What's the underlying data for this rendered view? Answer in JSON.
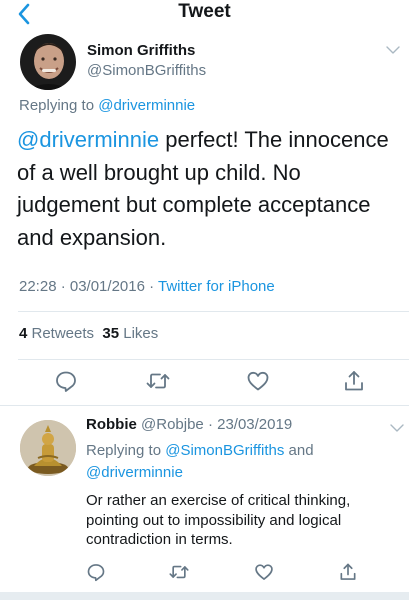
{
  "header": {
    "title": "Tweet"
  },
  "tweet": {
    "author_name": "Simon Griffiths",
    "author_handle": "@SimonBGriffiths",
    "replying_prefix": "Replying to ",
    "replying_to": "@driverminnie",
    "text_mention": "@driverminnie",
    "text_body": " perfect! The innocence of a well brought up child. No judgement but complete acceptance and expansion.",
    "time": "22:28 · 03/01/2016 · ",
    "source": "Twitter for iPhone",
    "retweets_count": "4",
    "retweets_label": " Retweets  ",
    "likes_count": "35",
    "likes_label": " Likes"
  },
  "reply": {
    "author_name": "Robbie",
    "author_handle": " @Robjbe · 23/03/2019",
    "replying_prefix": "Replying to ",
    "replying_to_1": "@SimonBGriffiths",
    "replying_and": " and",
    "replying_to_2": "@driverminnie",
    "text": "Or rather an exercise of critical thinking, pointing out to impossibility and logical contradiction in terms."
  },
  "icons": {
    "back": "chevron-left-icon",
    "more": "chevron-down-icon",
    "reply": "reply-icon",
    "retweet": "retweet-icon",
    "like": "heart-icon",
    "share": "share-icon"
  },
  "colors": {
    "accent": "#1b95e0",
    "secondary_text": "#657786",
    "primary_text": "#14171a",
    "divider": "#e1e8ed"
  }
}
